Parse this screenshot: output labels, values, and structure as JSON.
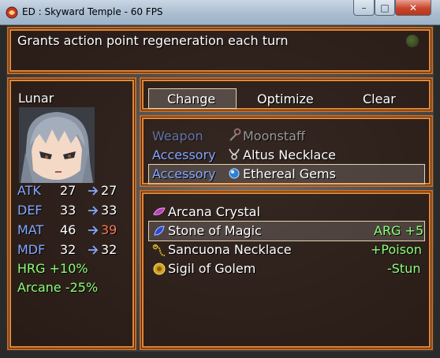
{
  "window": {
    "title": "ED : Skyward Temple - 60 FPS",
    "controls": {
      "minimize": "–",
      "maximize": "□",
      "close": "✕"
    }
  },
  "help": {
    "text": "Grants action point regeneration each turn"
  },
  "actor": {
    "name": "Lunar",
    "stats": [
      {
        "label": "ATK",
        "current": "27",
        "new": "27",
        "trend": "same"
      },
      {
        "label": "DEF",
        "current": "33",
        "new": "33",
        "trend": "same"
      },
      {
        "label": "MAT",
        "current": "46",
        "new": "39",
        "trend": "down"
      },
      {
        "label": "MDF",
        "current": "32",
        "new": "32",
        "trend": "same"
      }
    ],
    "traits": [
      "HRG +10%",
      "Arcane -25%"
    ]
  },
  "commands": {
    "change": "Change",
    "optimize": "Optimize",
    "clear": "Clear",
    "selected": "Change"
  },
  "equipment": [
    {
      "slot": "Weapon",
      "item": "Moonstaff",
      "icon": "staff-icon",
      "enabled": false
    },
    {
      "slot": "Accessory",
      "item": "Altus Necklace",
      "icon": "necklace-icon",
      "enabled": true
    },
    {
      "slot": "Accessory",
      "item": "Ethereal Gems",
      "icon": "gem-icon",
      "enabled": true,
      "selected": true
    }
  ],
  "items": [
    {
      "name": "Arcana Crystal",
      "effect": "",
      "icon": "crystal-icon"
    },
    {
      "name": "Stone of Magic",
      "effect": "ARG +5",
      "icon": "stone-icon",
      "selected": true
    },
    {
      "name": "Sancuona Necklace",
      "effect": "+Poison",
      "icon": "chain-icon"
    },
    {
      "name": "Sigil of Golem",
      "effect": "-Stun",
      "icon": "sigil-icon"
    }
  ],
  "colors": {
    "system": "#84a8ff",
    "positive": "#8cff7a",
    "negative": "#f47a5a",
    "frame": "#c56a22",
    "window_bg": "#28180f"
  }
}
